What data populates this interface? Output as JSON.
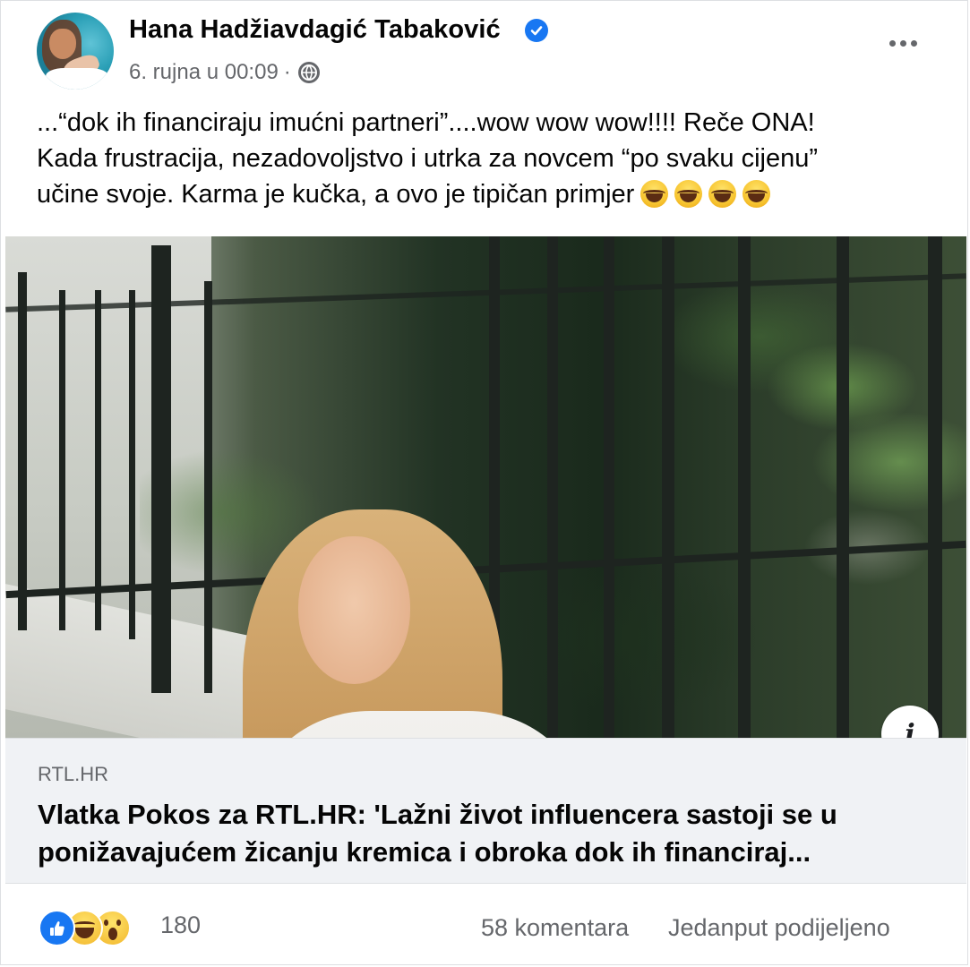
{
  "post": {
    "author": "Hana Hadžiavdagić Tabaković",
    "timestamp": "6. rujna u 00:09",
    "separator": "·",
    "text_lines": [
      "...“dok ih financiraju imućni partneri”....wow wow wow!!!! Reče ONA!",
      "Kada frustracija, nezadovoljstvo i utrka za novcem “po svaku cijenu”",
      "učine svoje. Karma je kučka, a ovo je tipičan primjer"
    ],
    "emoji_count": 4
  },
  "link_preview": {
    "domain": "RTL.HR",
    "title_lines": [
      "Vlatka Pokos za RTL.HR: 'Lažni život influencera sastoji se u",
      "ponižavajućem žicanju kremica i obroka dok ih financiraj..."
    ],
    "info_label": "i"
  },
  "footer": {
    "reaction_count": "180",
    "comments": "58 komentara",
    "shares": "Jedanput podijeljeno"
  },
  "icons": {
    "verified": "verified-badge-icon",
    "audience": "globe-icon",
    "more": "more-options-icon"
  },
  "colors": {
    "accent": "#1877f2",
    "secondary_text": "#65676b"
  }
}
